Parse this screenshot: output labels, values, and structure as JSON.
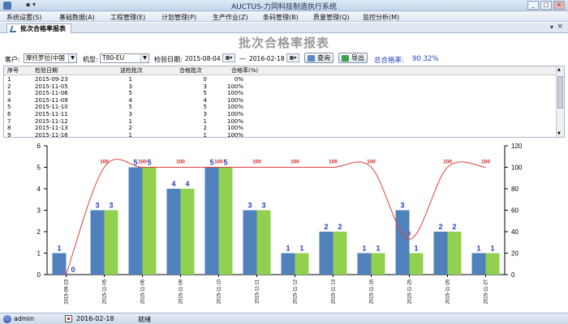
{
  "window": {
    "title": "AUCTUS-力同科技制造执行系统",
    "quick_access": "▪ ▾"
  },
  "menu": [
    "系统设置(S)",
    "基础数据(A)",
    "工程管理(E)",
    "计划管理(P)",
    "生产作业(Z)",
    "条码管理(B)",
    "质量管理(Q)",
    "监控分析(M)"
  ],
  "tab": {
    "label": "批次合格率报表",
    "menu": "▾",
    "close": "×"
  },
  "report": {
    "title": "批次合格率报表"
  },
  "filters": {
    "customer_label": "客户:",
    "customer_value": "摩托罗拉(中国",
    "model_label": "机型:",
    "model_value": "T80-EU",
    "date_label": "检验日期:",
    "date_from": "2015-08-04",
    "date_sep": "—",
    "date_to": "2016-02-18",
    "query_button": "查询",
    "export_button": "导出",
    "rate_label": "总合格率:",
    "rate_value": "90.32%"
  },
  "table": {
    "headers": [
      "序号",
      "检验日期",
      "送检批次",
      "合格批次",
      "合格率(%)"
    ],
    "rows": [
      [
        "1",
        "2015-09-23",
        "1",
        "0",
        "0%"
      ],
      [
        "2",
        "2015-11-05",
        "3",
        "3",
        "100%"
      ],
      [
        "3",
        "2015-11-06",
        "5",
        "5",
        "100%"
      ],
      [
        "4",
        "2015-11-09",
        "4",
        "4",
        "100%"
      ],
      [
        "5",
        "2015-11-10",
        "5",
        "5",
        "100%"
      ],
      [
        "6",
        "2015-11-11",
        "3",
        "3",
        "100%"
      ],
      [
        "7",
        "2015-11-12",
        "1",
        "1",
        "100%"
      ],
      [
        "8",
        "2015-11-13",
        "2",
        "2",
        "100%"
      ],
      [
        "9",
        "2015-11-16",
        "1",
        "1",
        "100%"
      ]
    ]
  },
  "chart_data": {
    "type": "bar",
    "categories": [
      "2015-09-23",
      "2015-11-05",
      "2015-11-06",
      "2015-11-09",
      "2015-11-10",
      "2015-11-11",
      "2015-11-12",
      "2015-11-13",
      "2015-11-16",
      "2015-11-25",
      "2015-11-26",
      "2015-11-27"
    ],
    "series": [
      {
        "name": "",
        "type": "bar",
        "axis": "left",
        "color": "#4f81bd",
        "values": [
          1,
          3,
          5,
          4,
          5,
          3,
          1,
          2,
          1,
          3,
          2,
          1
        ]
      },
      {
        "name": "",
        "type": "bar",
        "axis": "left",
        "color": "#92d050",
        "values": [
          0,
          3,
          5,
          4,
          5,
          3,
          1,
          2,
          1,
          1,
          2,
          1
        ]
      },
      {
        "name": "",
        "type": "line",
        "axis": "right",
        "color": "#e04040",
        "values": [
          0,
          100,
          100,
          100,
          100,
          100,
          100,
          100,
          100,
          33,
          100,
          100
        ]
      }
    ],
    "line_labels": [
      "",
      "100",
      "100",
      "100",
      "100",
      "100",
      "100",
      "100",
      "100",
      "3",
      "100",
      "100"
    ],
    "ylim_left": [
      0,
      6
    ],
    "yticks_left": [
      "0",
      "1",
      "2",
      "3",
      "4",
      "5",
      "6"
    ],
    "ylim_right": [
      0,
      120
    ],
    "yticks_right": [
      "0",
      "20",
      "40",
      "60",
      "80",
      "100",
      "120"
    ],
    "grid": false,
    "legend": "none"
  },
  "status": {
    "user": "admin",
    "date": "2016-02-18",
    "state": "就绪"
  }
}
